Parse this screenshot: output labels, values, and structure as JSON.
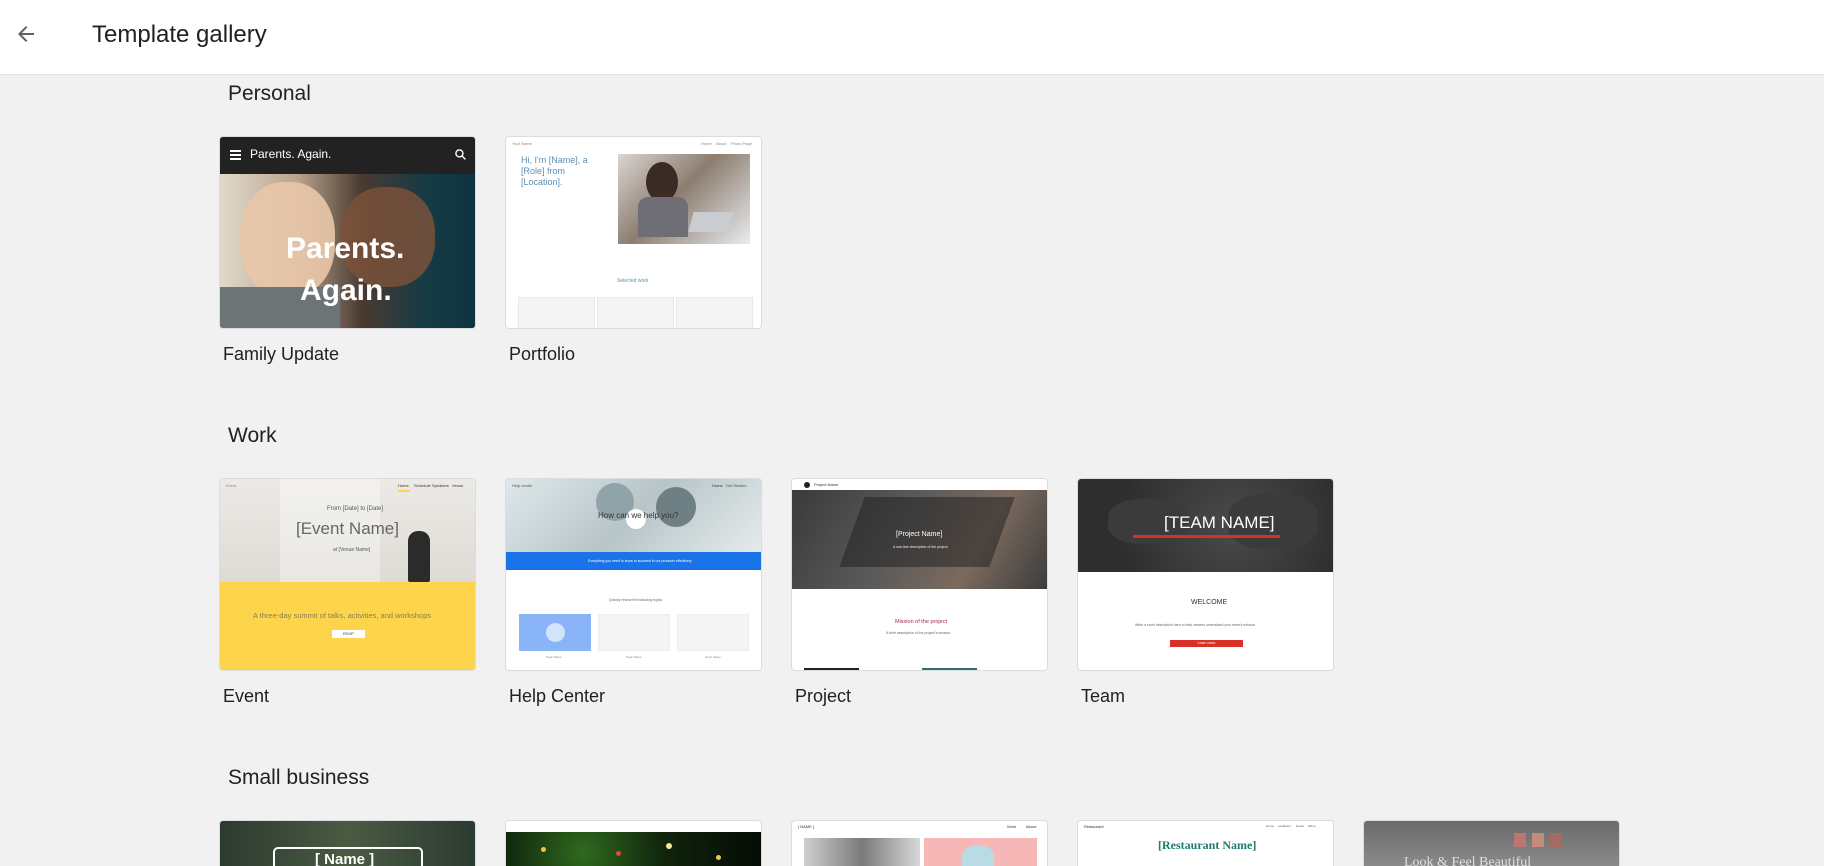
{
  "header": {
    "title": "Template gallery"
  },
  "sections": [
    {
      "title": "Personal",
      "templates": [
        {
          "label": "Family Update",
          "thumb": {
            "site_title": "Parents. Again.",
            "hero_line1": "Parents.",
            "hero_line2": "Again."
          }
        },
        {
          "label": "Portfolio",
          "thumb": {
            "site_name": "Your Name",
            "nav": [
              "Home",
              "About",
              "Photo Page"
            ],
            "intro": "Hi, I'm [Name], a [Role] from [Location].",
            "selected": "Selected work"
          }
        }
      ]
    },
    {
      "title": "Work",
      "templates": [
        {
          "label": "Event",
          "thumb": {
            "site_name": "Event",
            "nav": [
              "Home",
              "Schedule",
              "Speakers",
              "Venue"
            ],
            "date_line": "From [Date] to [Date]",
            "event_name": "[Event Name]",
            "venue_line": "at [Venue Name]",
            "summary": "A three-day summit of talks, activities, and workshops",
            "button": "RSVP"
          }
        },
        {
          "label": "Help Center",
          "thumb": {
            "site_name": "Help center",
            "nav": [
              "Home",
              "Get Started"
            ],
            "question": "How can we help you?",
            "banner": "Everything you need to know to succeed in our products effectively",
            "sub": "Quickly review the following topics",
            "topics": [
              "Topic Name",
              "Topic Name",
              "Topic Name"
            ]
          }
        },
        {
          "label": "Project",
          "thumb": {
            "site_name": "Project Name",
            "project_name": "[Project Name]",
            "desc": "A one-line description of the project",
            "mission": "Mission of the project",
            "mission_sub": "A brief description of the project's mission"
          }
        },
        {
          "label": "Team",
          "thumb": {
            "team_name": "[TEAM NAME]",
            "welcome": "WELCOME",
            "desc": "Write a short description here to help viewers understand your team's mission",
            "button": "Learn more"
          }
        }
      ]
    },
    {
      "title": "Small business",
      "templates": [
        {
          "label": "",
          "thumb": {
            "name": "[ Name ]"
          }
        },
        {
          "label": "",
          "thumb": {}
        },
        {
          "label": "",
          "thumb": {
            "name": "[ NAME ]",
            "nav": [
              "Work",
              "About"
            ]
          }
        },
        {
          "label": "",
          "thumb": {
            "site_name": "Restaurant",
            "restaurant_name": "[Restaurant Name]",
            "nav": [
              "Home",
              "Locations",
              "Hours",
              "Menu"
            ]
          }
        },
        {
          "label": "",
          "thumb": {
            "headline": "Look & Feel Beautiful"
          }
        }
      ]
    }
  ],
  "colors": {
    "accent_blue": "#1a73e8",
    "event_yellow": "#fdd54c",
    "team_red": "#d93025",
    "project_mission": "#9c2747"
  }
}
